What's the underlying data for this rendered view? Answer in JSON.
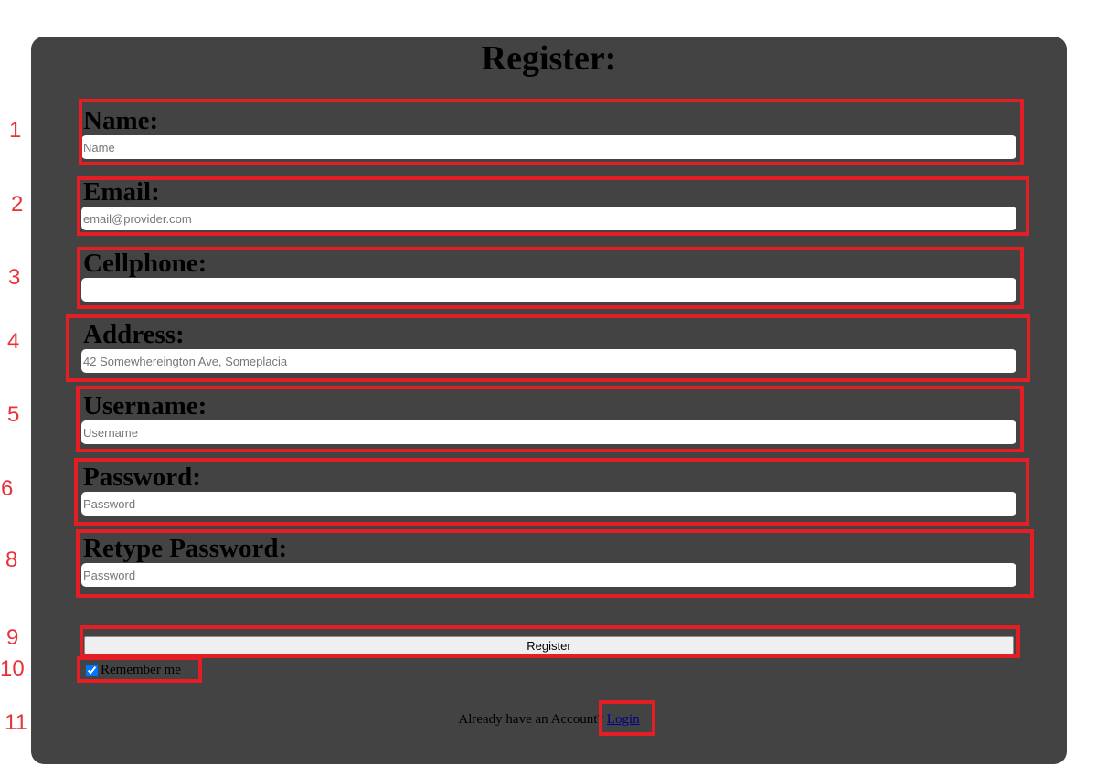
{
  "form": {
    "title": "Register:",
    "fields": [
      {
        "label": "Name:",
        "placeholder": "Name",
        "value": ""
      },
      {
        "label": "Email:",
        "placeholder": "email@provider.com",
        "value": ""
      },
      {
        "label": "Cellphone:",
        "placeholder": "",
        "value": ""
      },
      {
        "label": "Address:",
        "placeholder": "42 Somewhereington Ave, Someplacia",
        "value": ""
      },
      {
        "label": "Username:",
        "placeholder": "Username",
        "value": ""
      },
      {
        "label": "Password:",
        "placeholder": "Password",
        "value": ""
      },
      {
        "label": "Retype Password:",
        "placeholder": "Password",
        "value": ""
      }
    ],
    "register_label": "Register",
    "remember_label": "Remember me",
    "remember_checked": true,
    "already_text": "Already have an Account?",
    "login_label": "Login"
  },
  "annotations": {
    "color": "#e31e24",
    "numbers": [
      "1",
      "2",
      "3",
      "4",
      "5",
      "6",
      "8",
      "9",
      "10",
      "11"
    ]
  }
}
